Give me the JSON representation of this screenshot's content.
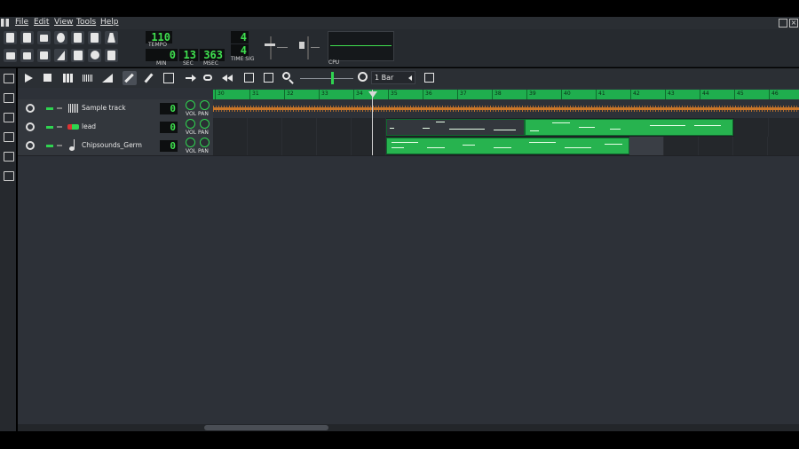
{
  "menu": {
    "items": [
      "File",
      "Edit",
      "View",
      "Tools",
      "Help"
    ]
  },
  "transport": {
    "tempo": "110",
    "tempo_label": "TEMPO",
    "min": "0",
    "min_label": "MIN",
    "sec": "13",
    "sec_label": "SEC",
    "msec": "363",
    "msec_label": "MSEC",
    "timesig_num": "4",
    "timesig_den": "4",
    "timesig_label": "TIME SIG",
    "cpu_label": "CPU"
  },
  "song_editor": {
    "snap_value": "1 Bar",
    "timeline_labels": [
      "30",
      "31",
      "32",
      "33",
      "34",
      "35",
      "36",
      "37",
      "38",
      "39",
      "40",
      "41",
      "42",
      "43",
      "44",
      "45",
      "46"
    ]
  },
  "tracks": [
    {
      "name": "Sample track",
      "value": "0",
      "vol_label": "VOL",
      "pan_label": "PAN",
      "icon": "waveform-icon"
    },
    {
      "name": "lead",
      "value": "0",
      "vol_label": "VOL",
      "pan_label": "PAN",
      "icon": "triple-oscillator-icon"
    },
    {
      "name": "Chipsounds_Germ",
      "value": "0",
      "vol_label": "VOL",
      "pan_label": "PAN",
      "icon": "note-icon"
    }
  ],
  "colors": {
    "accent": "#2fd450",
    "clip": "#27b34f",
    "waveform": "#c9762a",
    "timeline": "#1fae4e"
  }
}
